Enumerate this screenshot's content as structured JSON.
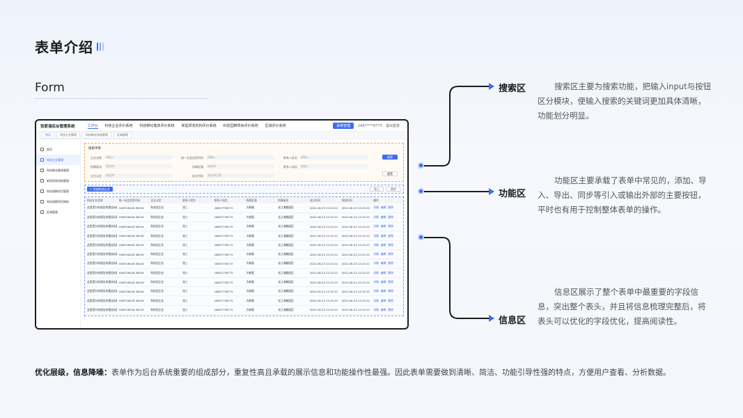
{
  "heading": {
    "title": "表单介绍",
    "subtitle": "Form"
  },
  "screenshot": {
    "app_name": "张家港后台管理系统",
    "nav": [
      "工作台",
      "科技企业评价系统",
      "科技孵化载体评价系统",
      "新型研发机构评价系统",
      "科技园孵项目评价系统",
      "区域评价系统"
    ],
    "system_button": "系统管理",
    "user": "166*****6773",
    "exit": "退出登录",
    "tabs": [
      "首页",
      "科技企业管理",
      "科技孵化系统管理",
      "区域管理"
    ],
    "sidebar": [
      "首页",
      "科技企业管理",
      "科技孵化载体管理",
      "新型研发机构管理",
      "科技园孵项目管理",
      "科技园孵项目审核",
      "区域管理"
    ],
    "search": {
      "title": "搜索项目",
      "fields": [
        {
          "label": "企业名称",
          "placeholder": "请输入"
        },
        {
          "label": "统一社会信用代码",
          "placeholder": "请输入"
        },
        {
          "label": "联系人姓名",
          "placeholder": "请输入"
        },
        {
          "label": "所属板块",
          "placeholder": "请选择"
        },
        {
          "label": "所属区镇",
          "placeholder": "请选择"
        },
        {
          "label": "联系人电话",
          "placeholder": "请输入"
        },
        {
          "label": "企业认定",
          "placeholder": "请选择"
        },
        {
          "label": "成立时间",
          "placeholder": "请选择日期"
        }
      ],
      "search_button": "搜索",
      "reset_button": "重置"
    },
    "functions": {
      "add": "+ 添加科技企业",
      "import": "导入",
      "sync": "同步"
    },
    "table": {
      "headers": [
        "科技企业名称",
        "统一社会信用代码",
        "企业认定",
        "联系人姓名",
        "联系人电话",
        "所属区镇",
        "所属板块",
        "成立时间",
        "添加时间",
        "操作"
      ],
      "row": [
        "这里是分析报告的报告标题...",
        "GH8726428 36234",
        "科技型企业",
        "张三",
        "18637736773",
        "大新镇",
        "长江海路园区",
        "2022-06-23 12:23:12",
        "2022-06-23 12:23:12"
      ],
      "ops": [
        "详情",
        "编辑",
        "删除"
      ],
      "row_count": 13
    }
  },
  "annotations": {
    "search": {
      "title": "搜索区",
      "text": "搜索区主要为搜索功能，把输入input与按钮区分模块，使输入搜索的关键词更加具体清晰，功能划分明显。"
    },
    "function": {
      "title": "功能区",
      "text": "功能区主要承载了表单中常见的，添加、导入、导出、同步等引入或输出外部的主要按钮，平时也有用于控制整体表单的操作。"
    },
    "info": {
      "title": "信息区",
      "text": "信息区展示了整个表单中最重要的字段信息，突出整个表头，并且将信息梳理完整后，将表头可以优化的字段优化，提高阅读性。"
    }
  },
  "bottom_note": {
    "bold": "优化层级，信息降噪：",
    "text": "表单作为后台系统重要的组成部分，重复性高且承载的展示信息和功能操作性最强。因此表单需要做到清晰、简洁、功能引导性强的特点，方便用户查看、分析数据。"
  },
  "colors": {
    "accent": "#3d6cf0",
    "search_border": "#f0a35a",
    "info_border": "#7a9ce8"
  }
}
